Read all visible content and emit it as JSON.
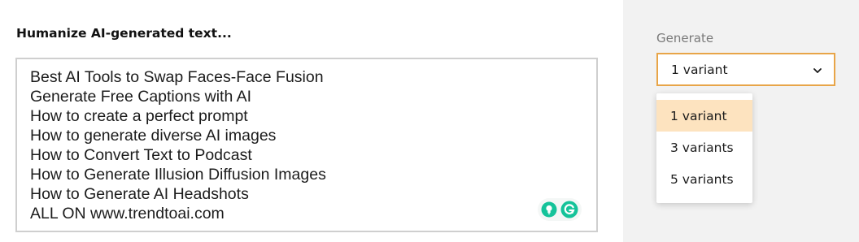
{
  "main": {
    "heading": "Humanize AI-generated text...",
    "text_lines": [
      "Best AI Tools to Swap Faces-Face Fusion",
      "Generate Free Captions with AI",
      "How to create a perfect prompt",
      "How to generate diverse AI images",
      "How to Convert Text to Podcast",
      "How to Generate Illusion Diffusion Images",
      "How to Generate AI Headshots",
      "ALL ON www.trendtoai.com"
    ],
    "extension_icons": [
      "lightbulb-icon",
      "grammarly-icon"
    ]
  },
  "sidebar": {
    "generate_label": "Generate",
    "select": {
      "value": "1 variant",
      "icon": "chevron-down-icon",
      "accent_color": "#e8a548"
    },
    "options": [
      "1 variant",
      "3 variants",
      "5 variants"
    ],
    "selected_index": 0,
    "highlight_color": "#fde3bf"
  }
}
